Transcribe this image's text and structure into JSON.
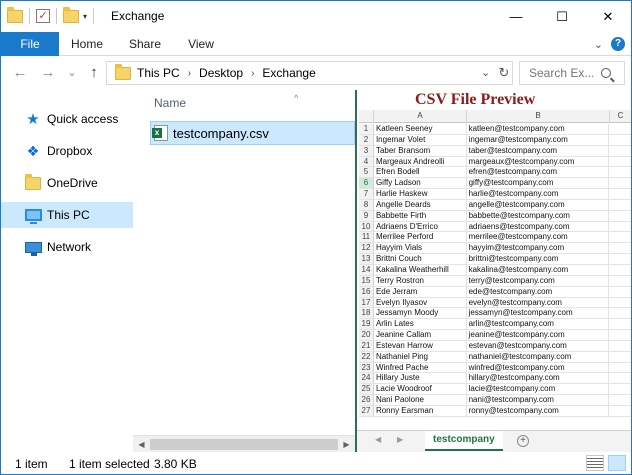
{
  "window": {
    "title": "Exchange",
    "qat_caret": "▾",
    "controls": {
      "minimize": "—",
      "maximize": "☐",
      "close": "✕"
    }
  },
  "ribbon": {
    "tabs": [
      "File",
      "Home",
      "Share",
      "View"
    ],
    "expand": "⌄",
    "help": "?"
  },
  "nav": {
    "back": "←",
    "forward": "→",
    "recent": "⌄",
    "up": "↑",
    "breadcrumb": [
      "This PC",
      "Desktop",
      "Exchange"
    ],
    "crumb_sep": "›",
    "dropdown": "⌄",
    "refresh": "↻",
    "search_placeholder": "Search Ex..."
  },
  "sidebar": {
    "items": [
      {
        "label": "Quick access",
        "icon": "star-icon"
      },
      {
        "label": "Dropbox",
        "icon": "dropbox-icon"
      },
      {
        "label": "OneDrive",
        "icon": "folder-icon"
      },
      {
        "label": "This PC",
        "icon": "computer-icon",
        "selected": true
      },
      {
        "label": "Network",
        "icon": "network-icon"
      }
    ]
  },
  "filelist": {
    "column_name": "Name",
    "sort_caret": "^",
    "files": [
      {
        "name": "testcompany.csv",
        "icon": "excel-csv-icon"
      }
    ],
    "scroll_left": "◀",
    "scroll_right": "▶"
  },
  "preview": {
    "title": "CSV File Preview",
    "columns": [
      "A",
      "B",
      "C"
    ],
    "rows": [
      [
        "1",
        "Katleen Seeney",
        "katleen@testcompany.com"
      ],
      [
        "2",
        "Ingemar Volet",
        "ingemar@testcompany.com"
      ],
      [
        "3",
        "Taber Bransom",
        "taber@testcompany.com"
      ],
      [
        "4",
        "Margeaux Andreolli",
        "margeaux@testcompany.com"
      ],
      [
        "5",
        "Efren Bodell",
        "efren@testcompany.com"
      ],
      [
        "6",
        "Giffy Ladson",
        "giffy@testcompany.com"
      ],
      [
        "7",
        "Harlie Haskew",
        "harlie@testcompany.com"
      ],
      [
        "8",
        "Angelle Deards",
        "angelle@testcompany.com"
      ],
      [
        "9",
        "Babbette Firth",
        "babbette@testcompany.com"
      ],
      [
        "10",
        "Adriaens D'Errico",
        "adriaens@testcompany.com"
      ],
      [
        "11",
        "Merrilee Perford",
        "merrilee@testcompany.com"
      ],
      [
        "12",
        "Hayyim Vials",
        "hayyim@testcompany.com"
      ],
      [
        "13",
        "Brittni Couch",
        "brittni@testcompany.com"
      ],
      [
        "14",
        "Kakalina Weatherhill",
        "kakalina@testcompany.com"
      ],
      [
        "15",
        "Terry Rostron",
        "terry@testcompany.com"
      ],
      [
        "16",
        "Ede Jerram",
        "ede@testcompany.com"
      ],
      [
        "17",
        "Evelyn Ilyasov",
        "evelyn@testcompany.com"
      ],
      [
        "18",
        "Jessamyn Moody",
        "jessamyn@testcompany.com"
      ],
      [
        "19",
        "Arlin Lates",
        "arlin@testcompany.com"
      ],
      [
        "20",
        "Jeanine Callam",
        "jeanine@testcompany.com"
      ],
      [
        "21",
        "Estevan Harrow",
        "estevan@testcompany.com"
      ],
      [
        "22",
        "Nathaniel Ping",
        "nathaniel@testcompany.com"
      ],
      [
        "23",
        "Winfred Pache",
        "winfred@testcompany.com"
      ],
      [
        "24",
        "Hillary Juste",
        "hillary@testcompany.com"
      ],
      [
        "25",
        "Lacie Woodroof",
        "lacie@testcompany.com"
      ],
      [
        "26",
        "Nani Paolone",
        "nani@testcompany.com"
      ],
      [
        "27",
        "Ronny Earsman",
        "ronny@testcompany.com"
      ]
    ],
    "active_row": "6",
    "sheet_tab": "testcompany",
    "tab_prev": "◀",
    "tab_next": "▶",
    "add_sheet": "+"
  },
  "status": {
    "item_count": "1 item",
    "selected": "1 item selected",
    "size": "3.80 KB"
  },
  "colors": {
    "accent": "#1979ca",
    "selection": "#cce8ff",
    "preview_title": "#8b1a1a",
    "excel_green": "#217346"
  }
}
